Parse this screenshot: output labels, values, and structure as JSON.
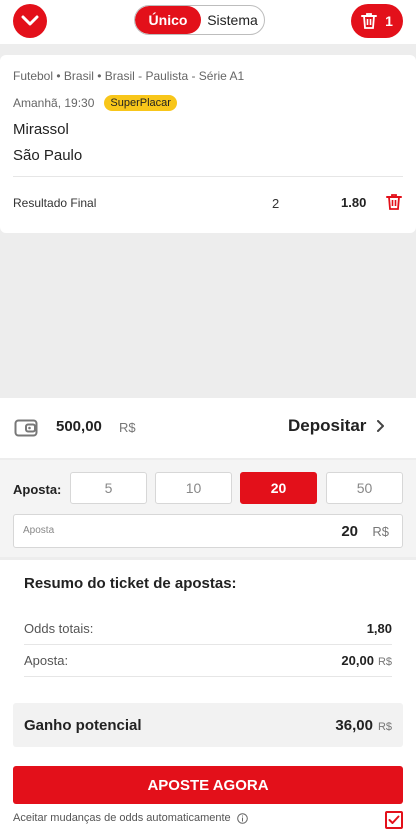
{
  "colors": {
    "accent": "#e3101a",
    "badge": "#f8c61a"
  },
  "header": {
    "collapse_icon": "chevron-down-icon",
    "mode_single": "Único",
    "mode_system": "Sistema",
    "selection_count": "1",
    "trash_icon": "trash-icon"
  },
  "bet": {
    "breadcrumb": "Futebol • Brasil • Brasil - Paulista - Série A1",
    "kickoff": "Amanhã, 19:30",
    "badge": "SuperPlacar",
    "home_team": "Mirassol",
    "away_team": "São Paulo",
    "market": "Resultado Final",
    "selection": "2",
    "odd": "1.80"
  },
  "wallet": {
    "icon": "wallet-icon",
    "balance": "500,00",
    "currency": "R$",
    "deposit_label": "Depositar"
  },
  "stake": {
    "label": "Aposta:",
    "chips": [
      "5",
      "10",
      "20",
      "50"
    ],
    "selected_chip": "20",
    "input_label": "Aposta",
    "input_value": "20",
    "input_currency": "R$"
  },
  "summary": {
    "title": "Resumo do ticket de apostas:",
    "odds_label": "Odds totais:",
    "odds_value": "1,80",
    "stake_label": "Aposta:",
    "stake_value": "20,00",
    "stake_currency": "R$",
    "potential_label": "Ganho potencial",
    "potential_value": "36,00",
    "potential_currency": "R$",
    "submit_label": "APOSTE AGORA",
    "accept_label": "Aceitar mudanças de odds automaticamente",
    "accept_checked": true
  }
}
